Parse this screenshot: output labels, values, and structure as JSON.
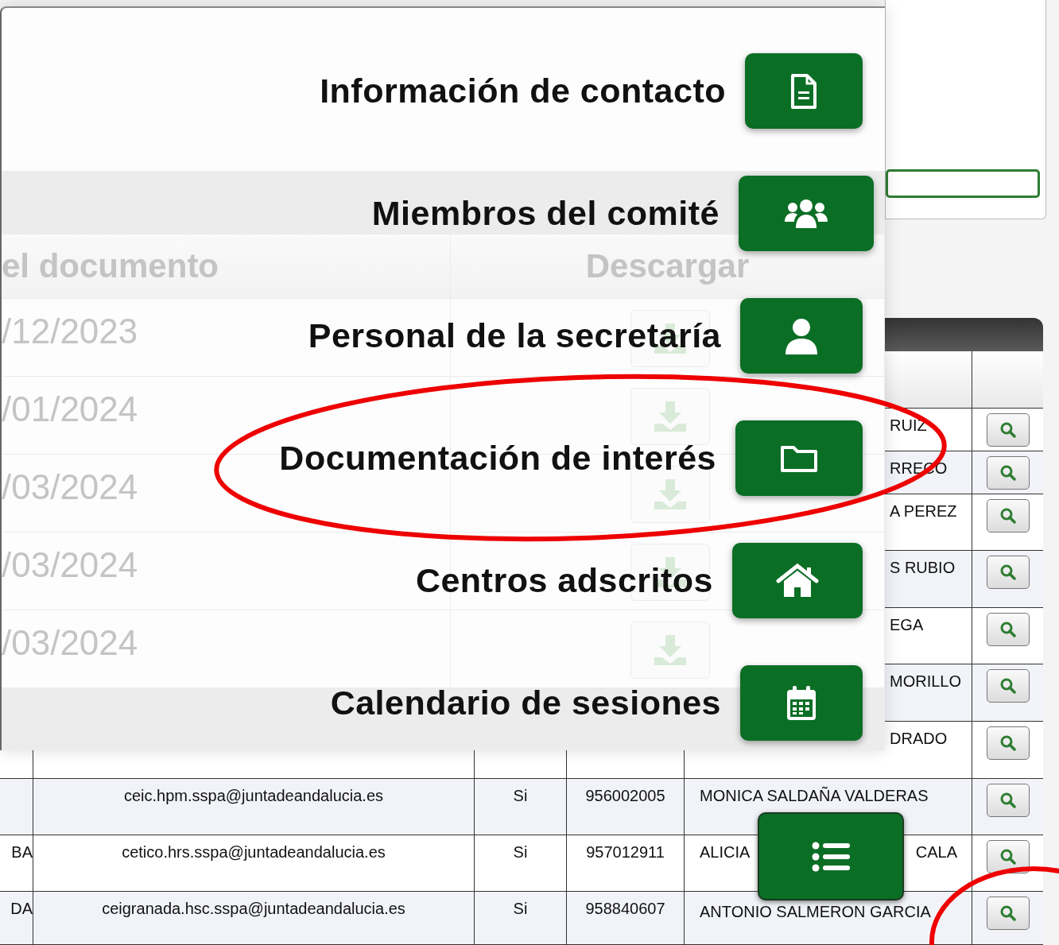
{
  "menu": {
    "items": [
      {
        "label": "Información de contacto"
      },
      {
        "label": "Miembros del comité"
      },
      {
        "label": "Personal de la secretaría"
      },
      {
        "label": "Documentación de interés"
      },
      {
        "label": "Centros adscritos"
      },
      {
        "label": "Calendario de sesiones"
      }
    ]
  },
  "faded_table": {
    "columns": [
      "el documento",
      "Descargar"
    ],
    "rows": [
      {
        "date": "/12/2023"
      },
      {
        "date": "/01/2024"
      },
      {
        "date": "/03/2024"
      },
      {
        "date": "/03/2024"
      },
      {
        "date": "/03/2024"
      }
    ]
  },
  "results_table": {
    "rows": [
      {
        "name": "RUIZ"
      },
      {
        "name": "RRECO"
      },
      {
        "name": "A PEREZ"
      },
      {
        "name": "S RUBIO"
      },
      {
        "name": "EGA"
      },
      {
        "name": "MORILLO"
      },
      {
        "name": "DRADO"
      },
      {
        "email": "ceic.hpm.sspa@juntadeandalucia.es",
        "active": "Si",
        "phone": "956002005",
        "name": "MONICA SALDAÑA VALDERAS"
      },
      {
        "column_1": "BA",
        "email": "cetico.hrs.sspa@juntadeandalucia.es",
        "active": "Si",
        "phone": "957012911",
        "name": "ALICIA",
        "name_end": "CALA"
      },
      {
        "column_1": "DA",
        "email": "ceigranada.hsc.sspa@juntadeandalucia.es",
        "active": "Si",
        "phone": "958840607",
        "name": "ANTONIO SALMERON GARCIA"
      }
    ]
  },
  "annotations": [
    {
      "kind": "ellipse"
    },
    {
      "kind": "ellipse"
    }
  ]
}
